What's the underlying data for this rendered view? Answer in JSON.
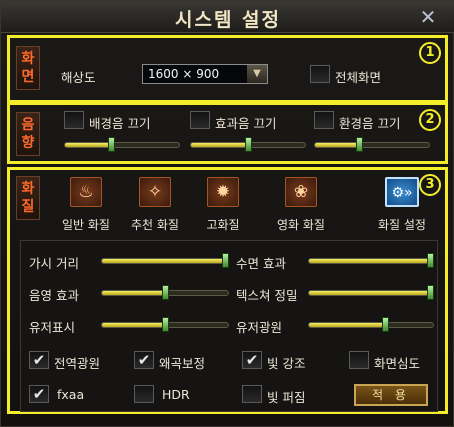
{
  "window": {
    "title": "시스템 설정",
    "close_icon": "close-icon"
  },
  "annotations": [
    "1",
    "2",
    "3"
  ],
  "display": {
    "label": "화면",
    "resolution_label": "해상도",
    "resolution_value": "1600 × 900",
    "fullscreen_label": "전체화면",
    "fullscreen_checked": false
  },
  "sound": {
    "label": "음향",
    "items": [
      {
        "label": "배경음 끄기",
        "checked": false,
        "volume": 0.4
      },
      {
        "label": "효과음 끄기",
        "checked": false,
        "volume": 0.5
      },
      {
        "label": "환경음 끄기",
        "checked": false,
        "volume": 0.38
      }
    ]
  },
  "quality": {
    "label": "화질",
    "presets": [
      {
        "label": "일반 화질",
        "icon": "flame-icon"
      },
      {
        "label": "추천 화질",
        "icon": "fire-icon"
      },
      {
        "label": "고화질",
        "icon": "burst-icon"
      },
      {
        "label": "영화 화질",
        "icon": "lotus-icon"
      },
      {
        "label": "화질 설정",
        "icon": "gear-arrows-icon"
      }
    ],
    "sliders_left": [
      {
        "label": "가시 거리",
        "value": 1.0
      },
      {
        "label": "음영 효과",
        "value": 0.5
      },
      {
        "label": "유저표시",
        "value": 0.5
      }
    ],
    "sliders_right": [
      {
        "label": "수면 효과",
        "value": 1.0
      },
      {
        "label": "텍스쳐 정밀",
        "value": 1.0
      },
      {
        "label": "유저광원",
        "value": 0.62
      }
    ],
    "checkboxes": [
      {
        "label": "전역광원",
        "checked": true
      },
      {
        "label": "왜곡보정",
        "checked": true
      },
      {
        "label": "빛 강조",
        "checked": true
      },
      {
        "label": "화면심도",
        "checked": false
      },
      {
        "label": "fxaa",
        "checked": true
      },
      {
        "label": "HDR",
        "checked": false
      },
      {
        "label": "빛 퍼짐",
        "checked": false
      }
    ],
    "apply_label": "적 용"
  },
  "colors": {
    "accent": "#f4ee2a",
    "orange": "#ff6a2a"
  }
}
